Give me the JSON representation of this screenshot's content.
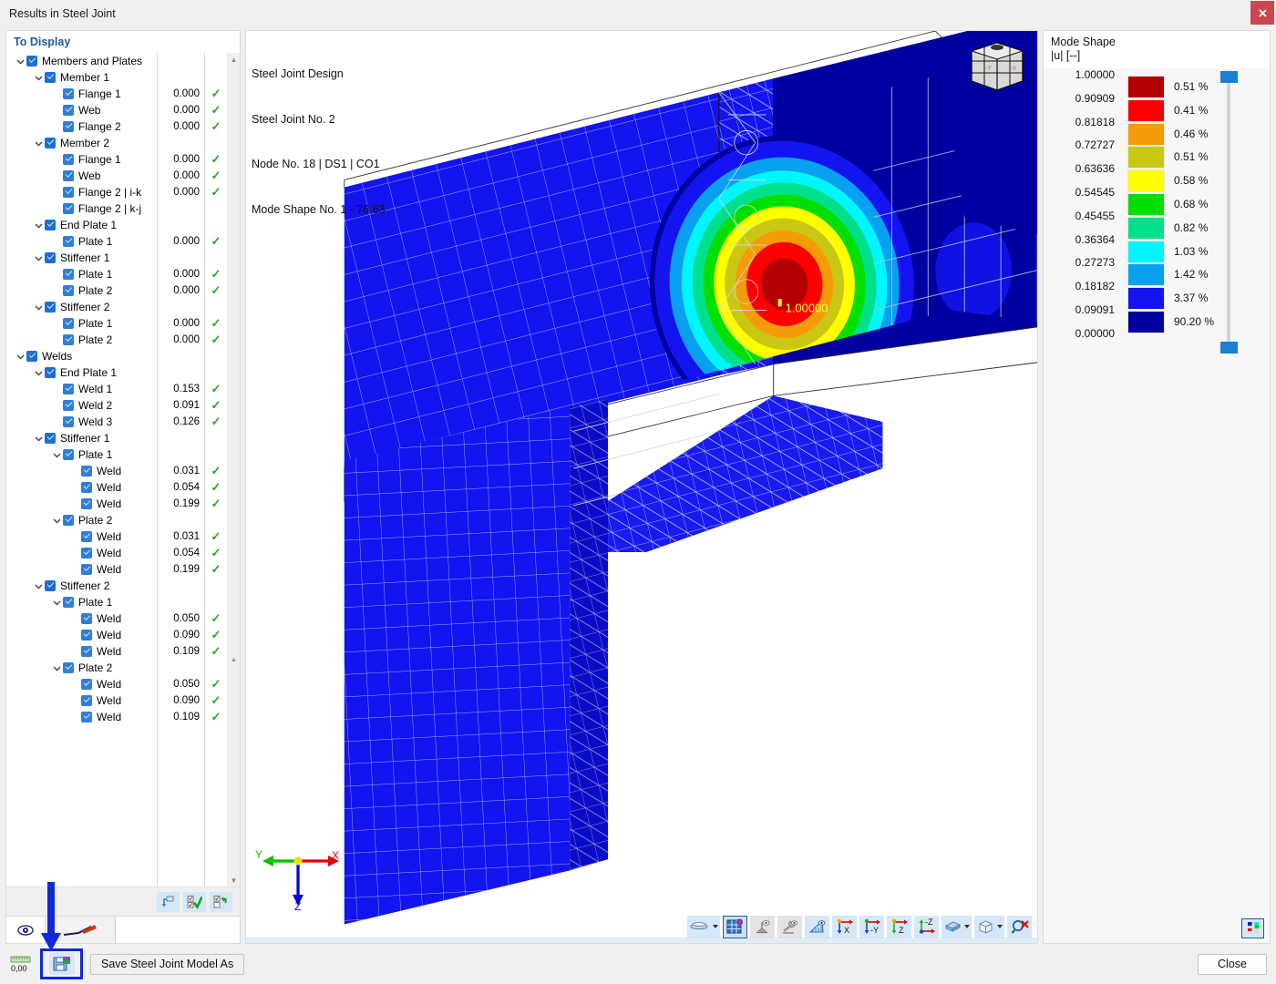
{
  "window": {
    "title": "Results in Steel Joint",
    "close_icon": "close-x-icon"
  },
  "left_panel": {
    "header": "To Display",
    "tree": [
      {
        "depth": 0,
        "chev": "down",
        "cb": true,
        "label": "Members and Plates",
        "value": "",
        "tick": false
      },
      {
        "depth": 1,
        "chev": "down",
        "cb": true,
        "label": "Member 1",
        "value": "",
        "tick": false
      },
      {
        "depth": 2,
        "chev": "none",
        "cb": true,
        "label": "Flange 1",
        "value": "0.000",
        "tick": true
      },
      {
        "depth": 2,
        "chev": "none",
        "cb": true,
        "label": "Web",
        "value": "0.000",
        "tick": true
      },
      {
        "depth": 2,
        "chev": "none",
        "cb": true,
        "label": "Flange 2",
        "value": "0.000",
        "tick": true
      },
      {
        "depth": 1,
        "chev": "down",
        "cb": true,
        "label": "Member 2",
        "value": "",
        "tick": false
      },
      {
        "depth": 2,
        "chev": "none",
        "cb": true,
        "label": "Flange 1",
        "value": "0.000",
        "tick": true
      },
      {
        "depth": 2,
        "chev": "none",
        "cb": true,
        "label": "Web",
        "value": "0.000",
        "tick": true
      },
      {
        "depth": 2,
        "chev": "none",
        "cb": true,
        "label": "Flange 2 | i-k",
        "value": "0.000",
        "tick": true
      },
      {
        "depth": 2,
        "chev": "none",
        "cb": true,
        "label": "Flange 2 | k-j",
        "value": "",
        "tick": false
      },
      {
        "depth": 1,
        "chev": "down",
        "cb": true,
        "label": "End Plate 1",
        "value": "",
        "tick": false
      },
      {
        "depth": 2,
        "chev": "none",
        "cb": true,
        "label": "Plate 1",
        "value": "0.000",
        "tick": true
      },
      {
        "depth": 1,
        "chev": "down",
        "cb": true,
        "label": "Stiffener 1",
        "value": "",
        "tick": false
      },
      {
        "depth": 2,
        "chev": "none",
        "cb": true,
        "label": "Plate 1",
        "value": "0.000",
        "tick": true
      },
      {
        "depth": 2,
        "chev": "none",
        "cb": true,
        "label": "Plate 2",
        "value": "0.000",
        "tick": true
      },
      {
        "depth": 1,
        "chev": "down",
        "cb": true,
        "label": "Stiffener 2",
        "value": "",
        "tick": false
      },
      {
        "depth": 2,
        "chev": "none",
        "cb": true,
        "label": "Plate 1",
        "value": "0.000",
        "tick": true
      },
      {
        "depth": 2,
        "chev": "none",
        "cb": true,
        "label": "Plate 2",
        "value": "0.000",
        "tick": true
      },
      {
        "depth": 0,
        "chev": "down",
        "cb": true,
        "label": "Welds",
        "value": "",
        "tick": false
      },
      {
        "depth": 1,
        "chev": "down",
        "cb": true,
        "label": "End Plate 1",
        "value": "",
        "tick": false
      },
      {
        "depth": 2,
        "chev": "none",
        "cb": true,
        "label": "Weld 1",
        "value": "0.153",
        "tick": true
      },
      {
        "depth": 2,
        "chev": "none",
        "cb": true,
        "label": "Weld 2",
        "value": "0.091",
        "tick": true
      },
      {
        "depth": 2,
        "chev": "none",
        "cb": true,
        "label": "Weld 3",
        "value": "0.126",
        "tick": true
      },
      {
        "depth": 1,
        "chev": "down",
        "cb": true,
        "label": "Stiffener 1",
        "value": "",
        "tick": false
      },
      {
        "depth": 2,
        "chev": "down",
        "cb": true,
        "label": "Plate 1",
        "value": "",
        "tick": false
      },
      {
        "depth": 3,
        "chev": "none",
        "cb": true,
        "label": "Weld",
        "value": "0.031",
        "tick": true
      },
      {
        "depth": 3,
        "chev": "none",
        "cb": true,
        "label": "Weld",
        "value": "0.054",
        "tick": true
      },
      {
        "depth": 3,
        "chev": "none",
        "cb": true,
        "label": "Weld",
        "value": "0.199",
        "tick": true
      },
      {
        "depth": 2,
        "chev": "down",
        "cb": true,
        "label": "Plate 2",
        "value": "",
        "tick": false
      },
      {
        "depth": 3,
        "chev": "none",
        "cb": true,
        "label": "Weld",
        "value": "0.031",
        "tick": true
      },
      {
        "depth": 3,
        "chev": "none",
        "cb": true,
        "label": "Weld",
        "value": "0.054",
        "tick": true
      },
      {
        "depth": 3,
        "chev": "none",
        "cb": true,
        "label": "Weld",
        "value": "0.199",
        "tick": true
      },
      {
        "depth": 1,
        "chev": "down",
        "cb": true,
        "label": "Stiffener 2",
        "value": "",
        "tick": false
      },
      {
        "depth": 2,
        "chev": "down",
        "cb": true,
        "label": "Plate 1",
        "value": "",
        "tick": false
      },
      {
        "depth": 3,
        "chev": "none",
        "cb": true,
        "label": "Weld",
        "value": "0.050",
        "tick": true
      },
      {
        "depth": 3,
        "chev": "none",
        "cb": true,
        "label": "Weld",
        "value": "0.090",
        "tick": true
      },
      {
        "depth": 3,
        "chev": "none",
        "cb": true,
        "label": "Weld",
        "value": "0.109",
        "tick": true
      },
      {
        "depth": 2,
        "chev": "down",
        "cb": true,
        "label": "Plate 2",
        "value": "",
        "tick": false
      },
      {
        "depth": 3,
        "chev": "none",
        "cb": true,
        "label": "Weld",
        "value": "0.050",
        "tick": true
      },
      {
        "depth": 3,
        "chev": "none",
        "cb": true,
        "label": "Weld",
        "value": "0.090",
        "tick": true
      },
      {
        "depth": 3,
        "chev": "none",
        "cb": true,
        "label": "Weld",
        "value": "0.109",
        "tick": true
      }
    ],
    "footer_buttons": [
      {
        "name": "reset-selection-button",
        "icon": "reset-arrow-icon"
      },
      {
        "name": "select-all-button",
        "icon": "checkbox-check-icon"
      },
      {
        "name": "invert-selection-button",
        "icon": "checkbox-swap-icon"
      }
    ],
    "eye_icon": "eye-icon",
    "legend_preview_icon": "result-diagram-icon"
  },
  "viewport": {
    "info_lines": [
      "Steel Joint Design",
      "Steel Joint No. 2",
      "Node No. 18 | DS1 | CO1",
      "Mode Shape No. 1 - 76.63"
    ],
    "max_value_label": "1.00000",
    "navcube_labels": [
      "-Y",
      "-X"
    ],
    "axis_labels": {
      "x": "X",
      "y": "Y",
      "z": "Z"
    },
    "axis_colors": {
      "x": "#e00000",
      "y": "#00c000",
      "z": "#0000e0"
    },
    "toolbar": [
      {
        "name": "render-mode-button",
        "icon": "shading-icon",
        "dropdown": true,
        "state": "normal"
      },
      {
        "name": "mesh-display-button",
        "icon": "mesh-grid-icon",
        "dropdown": false,
        "state": "selected"
      },
      {
        "name": "support-view-button",
        "icon": "support-eye-icon",
        "dropdown": false,
        "state": "disabled"
      },
      {
        "name": "load-view-button",
        "icon": "load-eye-icon",
        "dropdown": false,
        "state": "disabled"
      },
      {
        "name": "measure-button",
        "icon": "ruler-eye-icon",
        "dropdown": false,
        "state": "normal"
      },
      {
        "name": "view-in-x-button",
        "icon": "axis-x-icon",
        "dropdown": false,
        "state": "normal"
      },
      {
        "name": "view-in-y-button",
        "icon": "axis-y-icon",
        "dropdown": false,
        "state": "normal"
      },
      {
        "name": "view-in-z-button",
        "icon": "axis-z-icon",
        "dropdown": false,
        "state": "normal"
      },
      {
        "name": "view-in-neg-z-button",
        "icon": "axis-neg-z-icon",
        "dropdown": false,
        "state": "normal"
      },
      {
        "name": "section-view-button",
        "icon": "slab-icon",
        "dropdown": true,
        "state": "normal"
      },
      {
        "name": "isometric-view-button",
        "icon": "cube-icon",
        "dropdown": true,
        "state": "normal"
      },
      {
        "name": "reset-zoom-button",
        "icon": "zoom-reset-icon",
        "dropdown": false,
        "state": "normal"
      }
    ]
  },
  "legend_panel": {
    "title": "Mode Shape",
    "subtitle": "|u| [--]",
    "scale_values": [
      "1.00000",
      "0.90909",
      "0.81818",
      "0.72727",
      "0.63636",
      "0.54545",
      "0.45455",
      "0.36364",
      "0.27273",
      "0.18182",
      "0.09091",
      "0.00000"
    ],
    "bands": [
      {
        "color": "#b40000",
        "percent": "0.51 %"
      },
      {
        "color": "#fa0000",
        "percent": "0.41 %"
      },
      {
        "color": "#f59b0a",
        "percent": "0.46 %"
      },
      {
        "color": "#c8c814",
        "percent": "0.51 %"
      },
      {
        "color": "#ffff00",
        "percent": "0.58 %"
      },
      {
        "color": "#00e000",
        "percent": "0.68 %"
      },
      {
        "color": "#00e08c",
        "percent": "0.82 %"
      },
      {
        "color": "#00f5ff",
        "percent": "1.03 %"
      },
      {
        "color": "#0aa0f0",
        "percent": "1.42 %"
      },
      {
        "color": "#1414f0",
        "percent": "3.37 %"
      },
      {
        "color": "#0000a0",
        "percent": "90.20 %"
      }
    ],
    "slider": {
      "name": "legend-range-slider",
      "handles": 2,
      "accent": "#1a7fd4"
    },
    "settings_icon": "legend-settings-icon"
  },
  "footer": {
    "length_value": "0,00",
    "length_icon": "ruler-icon",
    "save_model_icon": "save-joint-model-icon",
    "save_as_label": "Save Steel Joint Model As",
    "close_label": "Close",
    "highlight_color": "#1229d8"
  }
}
